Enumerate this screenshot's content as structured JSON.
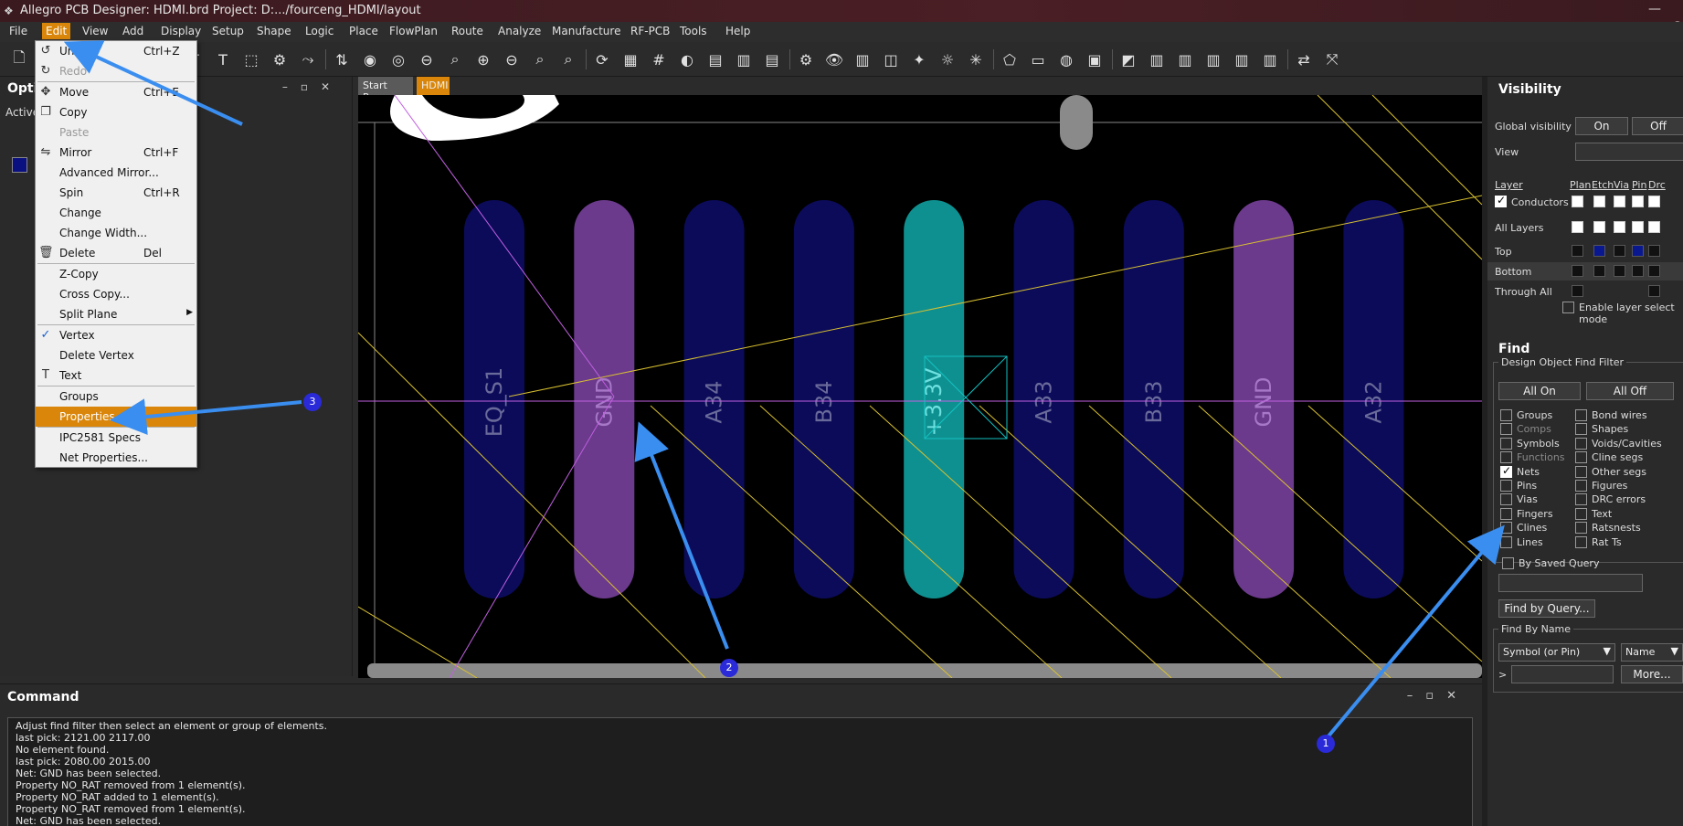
{
  "window": {
    "title": "Allegro PCB Designer: HDMI.brd  Project: D:.../fourceng_HDMI/layout",
    "right_char": "C"
  },
  "menubar": {
    "items": [
      "File",
      "Edit",
      "View",
      "Add",
      "Display",
      "Setup",
      "Shape",
      "Logic",
      "Place",
      "FlowPlan",
      "Route",
      "Analyze",
      "Manufacture",
      "RF-PCB",
      "Tools",
      "Help"
    ],
    "active": "Edit"
  },
  "edit_menu": {
    "items": [
      {
        "label": "Undo",
        "shortcut": "Ctrl+Z",
        "icon": "undo-icon",
        "disabled": false
      },
      {
        "label": "Redo",
        "shortcut": "",
        "icon": "redo-icon",
        "disabled": true
      },
      {
        "label": "Move",
        "shortcut": "Ctrl+E",
        "icon": "move-icon",
        "disabled": false
      },
      {
        "label": "Copy",
        "shortcut": "",
        "icon": "copy-icon",
        "disabled": false
      },
      {
        "label": "Paste",
        "shortcut": "",
        "icon": "",
        "disabled": true
      },
      {
        "label": "Mirror",
        "shortcut": "Ctrl+F",
        "icon": "mirror-icon",
        "disabled": false
      },
      {
        "label": "Advanced Mirror...",
        "shortcut": "",
        "icon": "",
        "disabled": false
      },
      {
        "label": "Spin",
        "shortcut": "Ctrl+R",
        "icon": "",
        "disabled": false
      },
      {
        "label": "Change",
        "shortcut": "",
        "icon": "",
        "disabled": false
      },
      {
        "label": "Change Width...",
        "shortcut": "",
        "icon": "",
        "disabled": false
      },
      {
        "label": "Delete",
        "shortcut": "Del",
        "icon": "trash-icon",
        "disabled": false
      },
      {
        "label": "Z-Copy",
        "shortcut": "",
        "icon": "",
        "disabled": false
      },
      {
        "label": "Cross Copy...",
        "shortcut": "",
        "icon": "",
        "disabled": false
      },
      {
        "label": "Split Plane",
        "shortcut": "",
        "icon": "",
        "disabled": false,
        "submenu": true
      },
      {
        "label": "Vertex",
        "shortcut": "",
        "icon": "check-icon",
        "disabled": false
      },
      {
        "label": "Delete Vertex",
        "shortcut": "",
        "icon": "",
        "disabled": false
      },
      {
        "label": "Text",
        "shortcut": "",
        "icon": "text-icon",
        "disabled": false
      },
      {
        "label": "Groups",
        "shortcut": "",
        "icon": "",
        "disabled": false
      },
      {
        "label": "Properties",
        "shortcut": "",
        "icon": "",
        "disabled": false,
        "highlight": true
      },
      {
        "label": "IPC2581 Specs",
        "shortcut": "",
        "icon": "",
        "disabled": false
      },
      {
        "label": "Net Properties...",
        "shortcut": "",
        "icon": "",
        "disabled": false
      }
    ]
  },
  "left_panel": {
    "title": "Opti",
    "active_label": "Active"
  },
  "tabs": [
    "Start Page",
    "HDMI"
  ],
  "board": {
    "pads": [
      {
        "label": "EQ_S1",
        "color": "#0b0b5a"
      },
      {
        "label": "GND",
        "color": "#6b3a8c"
      },
      {
        "label": "A34",
        "color": "#0b0b5a"
      },
      {
        "label": "B34",
        "color": "#0b0b5a"
      },
      {
        "label": "+3.3V",
        "color": "#0f9090"
      },
      {
        "label": "A33",
        "color": "#0b0b5a"
      },
      {
        "label": "B33",
        "color": "#0b0b5a"
      },
      {
        "label": "GND",
        "color": "#6b3a8c"
      },
      {
        "label": "A32",
        "color": "#0b0b5a"
      }
    ]
  },
  "visibility": {
    "title": "Visibility",
    "global_label": "Global visibility",
    "on_label": "On",
    "off_label": "Off",
    "view_label": "View",
    "columns": [
      "Layer",
      "Plan",
      "Etch",
      "Via",
      "Pin",
      "Drc"
    ],
    "rows": [
      "Conductors",
      "All Layers",
      "Top",
      "Bottom",
      "Through All"
    ],
    "enable_layer_select": "Enable layer select mode"
  },
  "find": {
    "title": "Find",
    "filter_title": "Design Object Find Filter",
    "all_on": "All On",
    "all_off": "All Off",
    "left_items": [
      {
        "label": "Groups",
        "checked": false,
        "dim": false
      },
      {
        "label": "Comps",
        "checked": false,
        "dim": true
      },
      {
        "label": "Symbols",
        "checked": false,
        "dim": false
      },
      {
        "label": "Functions",
        "checked": false,
        "dim": true
      },
      {
        "label": "Nets",
        "checked": true,
        "dim": false
      },
      {
        "label": "Pins",
        "checked": false,
        "dim": false
      },
      {
        "label": "Vias",
        "checked": false,
        "dim": false
      },
      {
        "label": "Fingers",
        "checked": false,
        "dim": false
      },
      {
        "label": "Clines",
        "checked": false,
        "dim": false
      },
      {
        "label": "Lines",
        "checked": false,
        "dim": false
      }
    ],
    "right_items": [
      {
        "label": "Bond wires",
        "checked": false
      },
      {
        "label": "Shapes",
        "checked": false
      },
      {
        "label": "Voids/Cavities",
        "checked": false
      },
      {
        "label": "Cline segs",
        "checked": false
      },
      {
        "label": "Other segs",
        "checked": false
      },
      {
        "label": "Figures",
        "checked": false
      },
      {
        "label": "DRC errors",
        "checked": false
      },
      {
        "label": "Text",
        "checked": false
      },
      {
        "label": "Ratsnests",
        "checked": false
      },
      {
        "label": "Rat Ts",
        "checked": false
      }
    ],
    "by_saved_query": "By Saved Query",
    "find_by_query": "Find by Query...",
    "find_by_name": "Find By Name",
    "symbol_select": "Symbol (or Pin)",
    "name_select": "Name",
    "prompt": ">",
    "more": "More..."
  },
  "command": {
    "title": "Command",
    "lines": [
      "Adjust find filter then select an element or group of elements.",
      "last pick:  2121.00 2117.00",
      "No element found.",
      "last pick:  2080.00 2015.00",
      "Net: GND has been selected.",
      "Property NO_RAT removed from 1 element(s).",
      "Property NO_RAT added to 1 element(s).",
      "Property NO_RAT removed from 1 element(s).",
      "Net: GND has been selected."
    ]
  },
  "annotations": {
    "badges": [
      "1",
      "2",
      "3"
    ],
    "arrow_color": "#3a8ef0"
  },
  "colors": {
    "accent": "#d9860a",
    "trace_yellow": "#d8c030",
    "ratsnest_purple": "#c060e0"
  }
}
